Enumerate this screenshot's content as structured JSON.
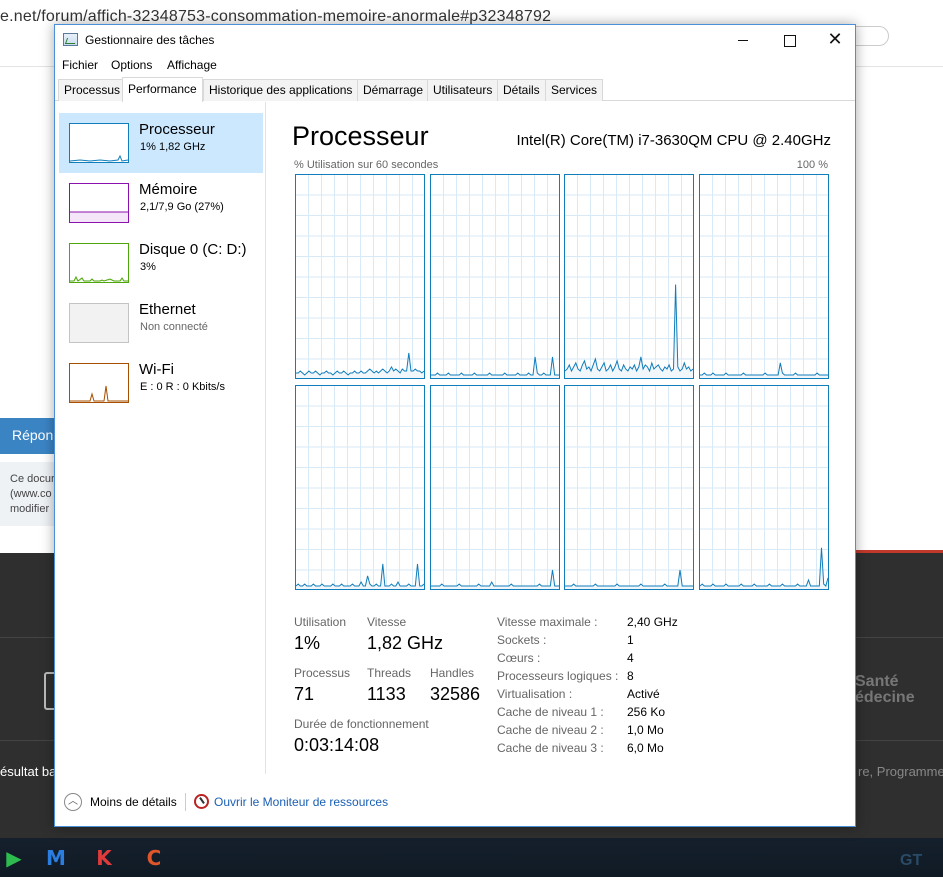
{
  "background": {
    "url_visible": "e.net/forum/affich-32348753-consommation-memoire-anormale#p32348792",
    "reply_button": "Répon",
    "note_lines": [
      "Ce docur",
      "(www.co",
      "modifier"
    ],
    "sante_text": [
      "Santé",
      "édecine"
    ],
    "result_text": "ésultat ba",
    "program_text": "re, Programme",
    "taskbar_brand": "GT"
  },
  "window": {
    "title": "Gestionnaire des tâches",
    "controls": {
      "minimize": "",
      "maximize": "",
      "close": "✕"
    },
    "menu": [
      "Fichier",
      "Options",
      "Affichage"
    ],
    "tabs": [
      "Processus",
      "Performance",
      "Historique des applications",
      "Démarrage",
      "Utilisateurs",
      "Détails",
      "Services"
    ],
    "active_tab": "Performance"
  },
  "sidebar": {
    "items": [
      {
        "name": "Processeur",
        "sub": "1%  1,82 GHz",
        "color": "#117dbb",
        "selected": true
      },
      {
        "name": "Mémoire",
        "sub": "2,1/7,9 Go (27%)",
        "color": "#8b12ae",
        "selected": false
      },
      {
        "name": "Disque 0 (C: D:)",
        "sub": "3%",
        "color": "#4da60c",
        "selected": false
      },
      {
        "name": "Ethernet",
        "sub": "Non connecté",
        "color": "#c4c4c4",
        "selected": false
      },
      {
        "name": "Wi-Fi",
        "sub": "E : 0 R : 0 Kbits/s",
        "color": "#a74f01",
        "selected": false
      }
    ]
  },
  "main": {
    "title": "Processeur",
    "model": "Intel(R) Core(TM) i7-3630QM CPU @ 2.40GHz",
    "graph_label": "% Utilisation sur 60 secondes",
    "graph_max": "100 %",
    "stats": {
      "utilisation_label": "Utilisation",
      "utilisation_value": "1%",
      "vitesse_label": "Vitesse",
      "vitesse_value": "1,82 GHz",
      "processus_label": "Processus",
      "processus_value": "71",
      "threads_label": "Threads",
      "threads_value": "1133",
      "handles_label": "Handles",
      "handles_value": "32586",
      "uptime_label": "Durée de fonctionnement",
      "uptime_value": "0:03:14:08"
    },
    "specs": [
      {
        "key": "Vitesse maximale :",
        "value": "2,40 GHz"
      },
      {
        "key": "Sockets :",
        "value": "1"
      },
      {
        "key": "Cœurs :",
        "value": "4"
      },
      {
        "key": "Processeurs logiques :",
        "value": "8"
      },
      {
        "key": "Virtualisation :",
        "value": "Activé"
      },
      {
        "key": "Cache de niveau 1 :",
        "value": "256 Ko"
      },
      {
        "key": "Cache de niveau 2 :",
        "value": "1,0 Mo"
      },
      {
        "key": "Cache de niveau 3 :",
        "value": "6,0 Mo"
      }
    ]
  },
  "chart_data": {
    "type": "line",
    "x_range": [
      60,
      0
    ],
    "ylim": [
      0,
      100
    ],
    "grid": true,
    "series": [
      {
        "values": [
          2,
          2,
          3,
          2,
          1,
          2,
          3,
          2,
          2,
          3,
          2,
          1,
          2,
          2,
          3,
          2,
          2,
          1,
          2,
          3,
          2,
          2,
          3,
          2,
          1,
          2,
          2,
          3,
          2,
          2,
          3,
          2,
          2,
          3,
          4,
          3,
          2,
          3,
          2,
          3,
          4,
          3,
          2,
          3,
          5,
          3,
          4,
          3,
          2,
          4,
          3,
          3,
          12,
          3,
          3,
          4,
          3,
          3,
          2,
          3
        ]
      },
      {
        "values": [
          1,
          1,
          1,
          2,
          1,
          1,
          1,
          1,
          2,
          1,
          1,
          1,
          1,
          1,
          2,
          1,
          1,
          1,
          1,
          1,
          2,
          1,
          1,
          1,
          1,
          1,
          1,
          2,
          1,
          1,
          1,
          1,
          1,
          1,
          2,
          1,
          1,
          1,
          1,
          1,
          2,
          1,
          1,
          1,
          1,
          2,
          1,
          1,
          10,
          2,
          1,
          1,
          2,
          1,
          1,
          1,
          10,
          1,
          1,
          1
        ]
      },
      {
        "values": [
          3,
          4,
          6,
          3,
          5,
          7,
          4,
          3,
          6,
          8,
          4,
          5,
          3,
          6,
          9,
          4,
          3,
          5,
          7,
          3,
          4,
          6,
          3,
          5,
          8,
          4,
          3,
          6,
          4,
          3,
          5,
          4,
          6,
          3,
          5,
          10,
          4,
          6,
          5,
          3,
          7,
          4,
          5,
          6,
          4,
          3,
          5,
          4,
          6,
          3,
          4,
          46,
          5,
          3,
          4,
          7,
          4,
          5,
          3,
          4
        ]
      },
      {
        "values": [
          1,
          1,
          2,
          1,
          1,
          1,
          2,
          1,
          1,
          1,
          1,
          1,
          2,
          1,
          1,
          1,
          1,
          1,
          1,
          1,
          2,
          1,
          1,
          1,
          1,
          1,
          1,
          1,
          1,
          1,
          2,
          1,
          1,
          1,
          1,
          1,
          1,
          7,
          2,
          1,
          1,
          1,
          1,
          1,
          2,
          1,
          1,
          1,
          1,
          1,
          1,
          1,
          1,
          1,
          2,
          1,
          1,
          1,
          1,
          1
        ]
      },
      {
        "values": [
          1,
          2,
          1,
          1,
          2,
          1,
          1,
          1,
          2,
          1,
          1,
          1,
          2,
          1,
          1,
          1,
          1,
          2,
          1,
          1,
          1,
          2,
          1,
          1,
          1,
          1,
          2,
          1,
          1,
          1,
          3,
          1,
          1,
          6,
          2,
          1,
          1,
          2,
          1,
          1,
          12,
          1,
          1,
          1,
          2,
          1,
          1,
          3,
          1,
          1,
          1,
          1,
          2,
          1,
          1,
          1,
          12,
          1,
          1,
          2
        ]
      },
      {
        "values": [
          1,
          1,
          1,
          1,
          1,
          2,
          1,
          1,
          1,
          1,
          1,
          1,
          1,
          2,
          1,
          1,
          1,
          1,
          1,
          1,
          1,
          1,
          2,
          1,
          1,
          1,
          1,
          1,
          3,
          1,
          1,
          1,
          1,
          1,
          1,
          1,
          1,
          2,
          1,
          1,
          1,
          1,
          1,
          1,
          1,
          1,
          1,
          1,
          1,
          1,
          2,
          1,
          1,
          1,
          1,
          1,
          9,
          1,
          1,
          1
        ]
      },
      {
        "values": [
          1,
          1,
          1,
          1,
          2,
          1,
          1,
          1,
          1,
          1,
          1,
          1,
          1,
          1,
          2,
          1,
          1,
          1,
          1,
          1,
          1,
          1,
          1,
          1,
          2,
          1,
          1,
          1,
          1,
          1,
          1,
          1,
          1,
          1,
          1,
          2,
          1,
          1,
          1,
          1,
          1,
          1,
          1,
          1,
          1,
          1,
          2,
          1,
          1,
          1,
          1,
          1,
          1,
          9,
          1,
          1,
          1,
          1,
          1,
          1
        ]
      },
      {
        "values": [
          1,
          2,
          1,
          1,
          1,
          1,
          2,
          1,
          1,
          1,
          1,
          1,
          2,
          1,
          1,
          1,
          1,
          1,
          1,
          2,
          1,
          1,
          1,
          1,
          1,
          2,
          1,
          1,
          1,
          1,
          1,
          1,
          2,
          1,
          1,
          1,
          1,
          1,
          2,
          1,
          1,
          1,
          1,
          1,
          1,
          2,
          1,
          1,
          1,
          1,
          4,
          1,
          1,
          1,
          1,
          1,
          20,
          2,
          1,
          5
        ]
      }
    ]
  },
  "footer": {
    "fewer_details": "Moins de détails",
    "fewer_icon": "chevron-up",
    "resource_monitor": "Ouvrir le Moniteur de ressources"
  }
}
